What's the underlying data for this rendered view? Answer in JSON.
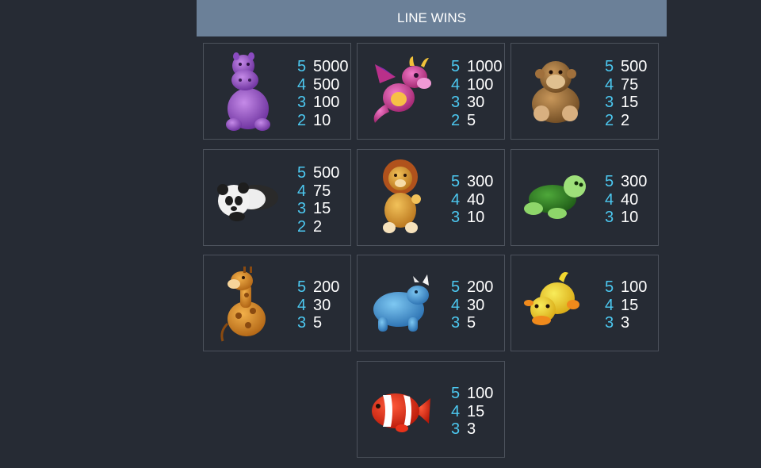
{
  "header": {
    "title": "LINE WINS"
  },
  "colors": {
    "background": "#262b34",
    "header": "#6b8098",
    "count": "#4cc8f0",
    "amount": "#ffffff",
    "card_border": "#4c525c"
  },
  "symbols": [
    {
      "icon": "purple-hippo-icon",
      "pays": [
        {
          "count": "5",
          "amount": "5000"
        },
        {
          "count": "4",
          "amount": "500"
        },
        {
          "count": "3",
          "amount": "100"
        },
        {
          "count": "2",
          "amount": "10"
        }
      ]
    },
    {
      "icon": "pink-dragon-icon",
      "pays": [
        {
          "count": "5",
          "amount": "1000"
        },
        {
          "count": "4",
          "amount": "100"
        },
        {
          "count": "3",
          "amount": "30"
        },
        {
          "count": "2",
          "amount": "5"
        }
      ]
    },
    {
      "icon": "monkey-icon",
      "pays": [
        {
          "count": "5",
          "amount": "500"
        },
        {
          "count": "4",
          "amount": "75"
        },
        {
          "count": "3",
          "amount": "15"
        },
        {
          "count": "2",
          "amount": "2"
        }
      ]
    },
    {
      "icon": "panda-icon",
      "pays": [
        {
          "count": "5",
          "amount": "500"
        },
        {
          "count": "4",
          "amount": "75"
        },
        {
          "count": "3",
          "amount": "15"
        },
        {
          "count": "2",
          "amount": "2"
        }
      ]
    },
    {
      "icon": "lion-icon",
      "pays": [
        {
          "count": "5",
          "amount": "300"
        },
        {
          "count": "4",
          "amount": "40"
        },
        {
          "count": "3",
          "amount": "10"
        }
      ]
    },
    {
      "icon": "turtle-icon",
      "pays": [
        {
          "count": "5",
          "amount": "300"
        },
        {
          "count": "4",
          "amount": "40"
        },
        {
          "count": "3",
          "amount": "10"
        }
      ]
    },
    {
      "icon": "giraffe-icon",
      "pays": [
        {
          "count": "5",
          "amount": "200"
        },
        {
          "count": "4",
          "amount": "30"
        },
        {
          "count": "3",
          "amount": "5"
        }
      ]
    },
    {
      "icon": "rhino-icon",
      "pays": [
        {
          "count": "5",
          "amount": "200"
        },
        {
          "count": "4",
          "amount": "30"
        },
        {
          "count": "3",
          "amount": "5"
        }
      ]
    },
    {
      "icon": "duck-icon",
      "pays": [
        {
          "count": "5",
          "amount": "100"
        },
        {
          "count": "4",
          "amount": "15"
        },
        {
          "count": "3",
          "amount": "3"
        }
      ]
    },
    {
      "icon": "clownfish-icon",
      "pays": [
        {
          "count": "5",
          "amount": "100"
        },
        {
          "count": "4",
          "amount": "15"
        },
        {
          "count": "3",
          "amount": "3"
        }
      ]
    }
  ]
}
